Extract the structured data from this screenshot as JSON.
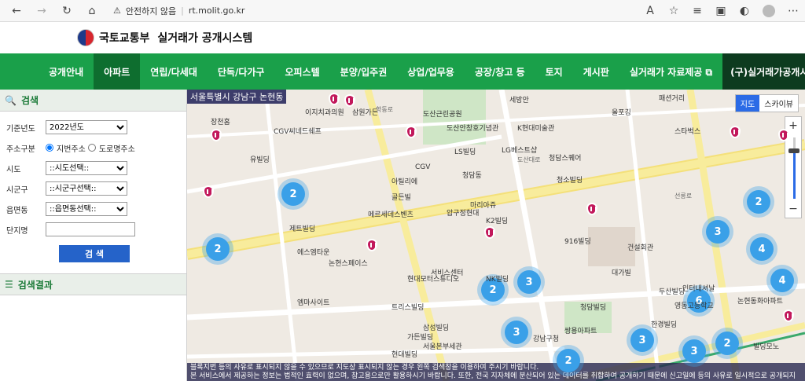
{
  "browser": {
    "warning": "안전하지 않음",
    "url": "rt.molit.go.kr"
  },
  "header": {
    "ministry": "국토교통부",
    "system": "실거래가 공개시스템"
  },
  "nav": {
    "items": [
      "공개안내",
      "아파트",
      "연립/다세대",
      "단독/다가구",
      "오피스텔",
      "분양/입주권",
      "상업/업무용",
      "공장/창고 등",
      "토지",
      "게시판",
      "실거래가 자료제공 ⧉"
    ],
    "active": 1,
    "legacy": "(구)실거래가공개시스템"
  },
  "search": {
    "title": "검색",
    "year_label": "기준년도",
    "year_value": "2022년도",
    "addr_type_label": "주소구분",
    "addr_jibun": "지번주소",
    "addr_road": "도로명주소",
    "sido_label": "시도",
    "sido_value": "::시도선택::",
    "sigungu_label": "시군구",
    "sigungu_value": "::시군구선택::",
    "dong_label": "읍면동",
    "dong_value": "::읍면동선택::",
    "complex_label": "단지명",
    "button": "검 색"
  },
  "results": {
    "title": "검색결과"
  },
  "map": {
    "location": "서울특별시 강남구 논현동",
    "type_map": "지도",
    "type_sky": "스카이뷰",
    "zoom_in": "+",
    "zoom_out": "−",
    "notice_line1": "블록지번 등의 사유로 표시되지 않을 수 있으므로 지도상 표시되지 않는 경우 왼쪽 검색창을 이용하여 주시기 바랍니다.",
    "notice_line2": "본 서비스에서 제공하는 정보는 법적인 효력이 없으며, 참고용으로만 활용하시기 바랍니다. 또한, 전국 지자체에 분산되어 있는 데이터를 취합하여 공개하기 때문에 신고일에 등의 사유로 일시적으로 공개되지",
    "clusters": [
      "2",
      "2",
      "2",
      "3",
      "3",
      "4",
      "2",
      "4",
      "6",
      "3",
      "2",
      "3",
      "2",
      "3"
    ],
    "places": [
      "이지치과의원",
      "삼원가든",
      "도산근린공원",
      "세방안",
      "CGV씨네드쉐프",
      "도산안창호기념관",
      "K현대미술관",
      "올포깅",
      "패션거리",
      "스타벅스",
      "장천홈",
      "LS빌딩",
      "LG베스트샵",
      "청담스퀘어",
      "유빌딩",
      "아틸리에",
      "CGV",
      "청담동",
      "청소빌딩",
      "골든빌",
      "압구정현대",
      "마리아쥬",
      "K2빌딩",
      "제트빌딩",
      "메르세데스벤츠",
      "916빌딩",
      "에스엠타운",
      "논현스페이스",
      "대가빌",
      "서비스센터",
      "현대모터스튜디오",
      "NK빌딩",
      "청담빌딩",
      "두산빌딩",
      "엠마사이트",
      "트리스빌딩",
      "쌍용아파트",
      "논현동화아파트",
      "한경빌딩",
      "영동고등학교",
      "삼성빌딩",
      "가든빌딩",
      "빌딩모노",
      "현대빌딩",
      "서울본부세관",
      "강남구청",
      "인터내셔날",
      "건설회관"
    ],
    "roads": [
      "도산대로",
      "학동로",
      "선릉로"
    ]
  }
}
